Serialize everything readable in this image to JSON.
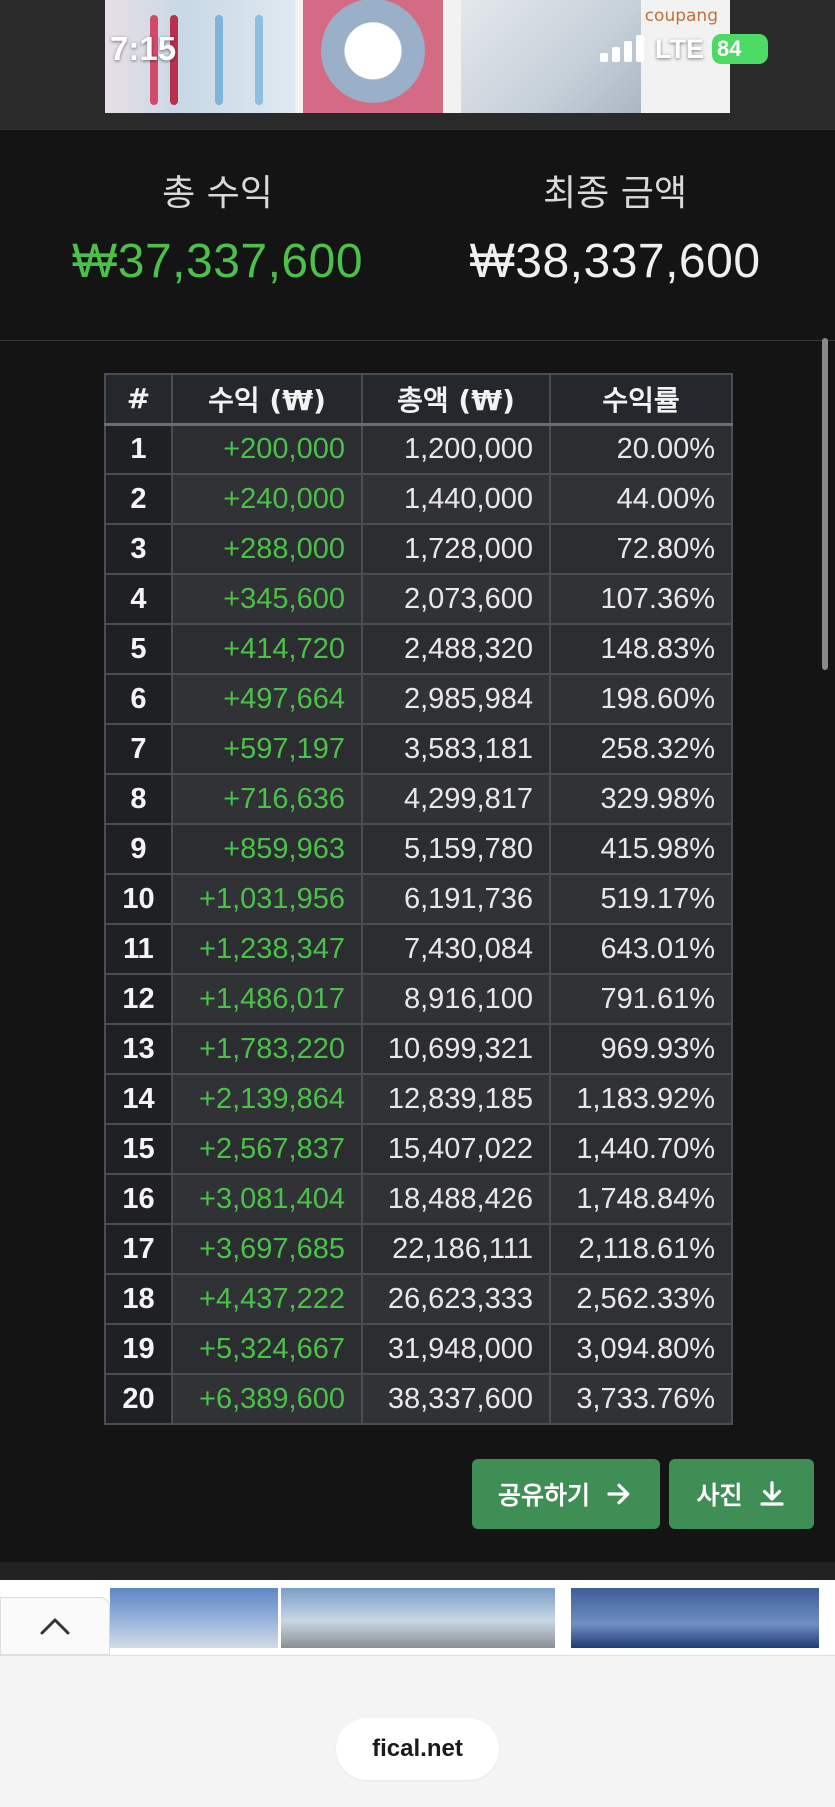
{
  "status_bar": {
    "time": "7:15",
    "network": "LTE",
    "battery": "84"
  },
  "ad_top": {
    "brand": "coupang"
  },
  "summary": {
    "total_profit_label": "총 수익",
    "total_profit_value": "₩37,337,600",
    "final_amount_label": "최종 금액",
    "final_amount_value": "₩38,337,600"
  },
  "table": {
    "headers": [
      "#",
      "수익 (₩)",
      "총액 (₩)",
      "수익률"
    ],
    "rows": [
      {
        "n": "1",
        "profit": "+200,000",
        "total": "1,200,000",
        "rate": "20.00%"
      },
      {
        "n": "2",
        "profit": "+240,000",
        "total": "1,440,000",
        "rate": "44.00%"
      },
      {
        "n": "3",
        "profit": "+288,000",
        "total": "1,728,000",
        "rate": "72.80%"
      },
      {
        "n": "4",
        "profit": "+345,600",
        "total": "2,073,600",
        "rate": "107.36%"
      },
      {
        "n": "5",
        "profit": "+414,720",
        "total": "2,488,320",
        "rate": "148.83%"
      },
      {
        "n": "6",
        "profit": "+497,664",
        "total": "2,985,984",
        "rate": "198.60%"
      },
      {
        "n": "7",
        "profit": "+597,197",
        "total": "3,583,181",
        "rate": "258.32%"
      },
      {
        "n": "8",
        "profit": "+716,636",
        "total": "4,299,817",
        "rate": "329.98%"
      },
      {
        "n": "9",
        "profit": "+859,963",
        "total": "5,159,780",
        "rate": "415.98%"
      },
      {
        "n": "10",
        "profit": "+1,031,956",
        "total": "6,191,736",
        "rate": "519.17%"
      },
      {
        "n": "11",
        "profit": "+1,238,347",
        "total": "7,430,084",
        "rate": "643.01%"
      },
      {
        "n": "12",
        "profit": "+1,486,017",
        "total": "8,916,100",
        "rate": "791.61%"
      },
      {
        "n": "13",
        "profit": "+1,783,220",
        "total": "10,699,321",
        "rate": "969.93%"
      },
      {
        "n": "14",
        "profit": "+2,139,864",
        "total": "12,839,185",
        "rate": "1,183.92%"
      },
      {
        "n": "15",
        "profit": "+2,567,837",
        "total": "15,407,022",
        "rate": "1,440.70%"
      },
      {
        "n": "16",
        "profit": "+3,081,404",
        "total": "18,488,426",
        "rate": "1,748.84%"
      },
      {
        "n": "17",
        "profit": "+3,697,685",
        "total": "22,186,111",
        "rate": "2,118.61%"
      },
      {
        "n": "18",
        "profit": "+4,437,222",
        "total": "26,623,333",
        "rate": "2,562.33%"
      },
      {
        "n": "19",
        "profit": "+5,324,667",
        "total": "31,948,000",
        "rate": "3,094.80%"
      },
      {
        "n": "20",
        "profit": "+6,389,600",
        "total": "38,337,600",
        "rate": "3,733.76%"
      }
    ]
  },
  "actions": {
    "share_label": "공유하기",
    "photo_label": "사진"
  },
  "browser": {
    "url": "fical.net"
  },
  "colors": {
    "accent_green": "#4cc04a",
    "button_green": "#3f8e56",
    "background": "#141414"
  },
  "icons": {
    "share": "arrow-right-icon",
    "photo": "download-icon",
    "collapse": "chevron-up-icon"
  }
}
